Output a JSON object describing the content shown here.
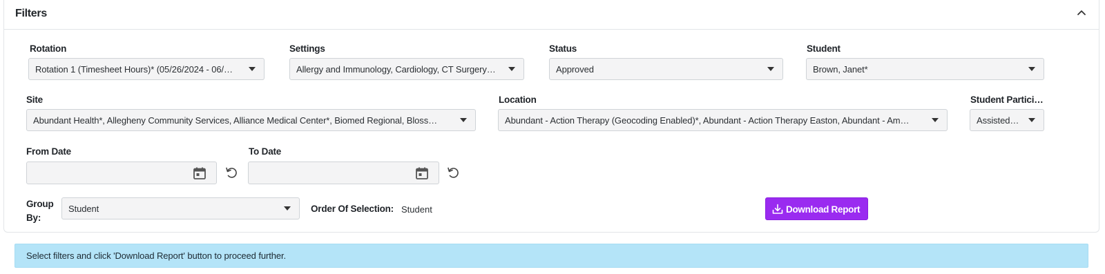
{
  "filters": {
    "title": "Filters",
    "rotation": {
      "label": "Rotation",
      "value": "Rotation 1 (Timesheet Hours)* (05/26/2024 - 06/…"
    },
    "settings": {
      "label": "Settings",
      "value": "Allergy and Immunology, Cardiology, CT Surgery…"
    },
    "status": {
      "label": "Status",
      "value": "Approved"
    },
    "student": {
      "label": "Student",
      "value": "Brown, Janet*"
    },
    "site": {
      "label": "Site",
      "value": "Abundant Health*, Allegheny Community Services, Alliance Medical Center*, Biomed Regional, Bloss…"
    },
    "location": {
      "label": "Location",
      "value": "Abundant - Action Therapy (Geocoding Enabled)*, Abundant - Action Therapy Easton, Abundant - Am…"
    },
    "student_participation": {
      "label": "Student Partici…",
      "value": "Assisted…"
    },
    "from_date": {
      "label": "From Date",
      "value": ""
    },
    "to_date": {
      "label": "To Date",
      "value": ""
    },
    "group_by": {
      "label_line1": "Group",
      "label_line2": "By:",
      "value": "Student"
    },
    "order_of_selection": {
      "label": "Order Of Selection:",
      "value": "Student"
    },
    "download_button": {
      "label": "Download Report"
    }
  },
  "alert": {
    "message": "Select filters and click 'Download Report' button to proceed further."
  },
  "icons": {
    "collapse": "chevron-up-icon",
    "calendar": "calendar-icon",
    "reset": "reset-icon",
    "download": "download-icon",
    "dropdown": "caret-down-icon"
  },
  "colors": {
    "accent": "#9a2bf0",
    "alert_bg": "#b4e4f8",
    "input_bg": "#f4f4f5"
  }
}
